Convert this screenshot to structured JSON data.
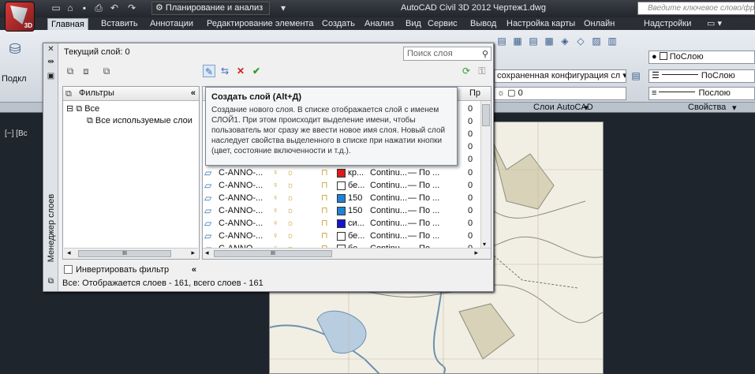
{
  "titlebar": {
    "workspace": "Планирование и анализ",
    "app_title": "AutoCAD Civil 3D 2012",
    "doc_title": "Чертеж1.dwg",
    "help_placeholder": "Введите ключевое слово/фразу",
    "app_tag": "3D"
  },
  "tabs": [
    "Главная",
    "Вставить",
    "Аннотации",
    "Редактирование элемента",
    "Создать",
    "Анализ",
    "Вид",
    "Сервис",
    "Вывод",
    "Настройка карты",
    "Онлайн",
    "Надстройки"
  ],
  "ribbon": {
    "left_panel_label": "Подкл",
    "saved_config": "сохраненная конфигурация сл",
    "layer_combo": "0",
    "layers_panel_title": "Слои AutoCAD",
    "props_panel_title": "Свойства",
    "color_value": "ПоСлою",
    "linetype_value": "ПоСлою",
    "lineweight_value": "Послою"
  },
  "drawing": {
    "viewport_label": "[−] [Вс"
  },
  "palette": {
    "strip_title": "Менеджер слоев",
    "current_layer": "Текущий слой: 0",
    "search_placeholder": "Поиск слоя",
    "filters_header": "Фильтры",
    "tree": {
      "all": "Все",
      "all_used": "Все используемые слои"
    },
    "invert_filter": "Инвертировать фильтр",
    "status": "Все: Отображается слоев - 161, всего слоев - 161",
    "col_pr": "Пр",
    "first_pr_values": [
      "0",
      "0",
      "0",
      "0",
      "0"
    ],
    "rows": [
      {
        "name": "C-ANNO-...",
        "color_name": "кр...",
        "color_hex": "#e01818",
        "linetype": "Continu...",
        "lineweight": "— По ...",
        "pr": "0"
      },
      {
        "name": "C-ANNO-...",
        "color_name": "бе...",
        "color_hex": "#ffffff",
        "linetype": "Continu...",
        "lineweight": "— По ...",
        "pr": "0"
      },
      {
        "name": "C-ANNO-...",
        "color_name": "150",
        "color_hex": "#1e82d8",
        "linetype": "Continu...",
        "lineweight": "— По ...",
        "pr": "0"
      },
      {
        "name": "C-ANNO-...",
        "color_name": "150",
        "color_hex": "#1e82d8",
        "linetype": "Continu...",
        "lineweight": "— По ...",
        "pr": "0"
      },
      {
        "name": "C-ANNO-...",
        "color_name": "си...",
        "color_hex": "#1414d0",
        "linetype": "Continu...",
        "lineweight": "— По ...",
        "pr": "0"
      },
      {
        "name": "C-ANNO-...",
        "color_name": "бе...",
        "color_hex": "#ffffff",
        "linetype": "Continu...",
        "lineweight": "— По ...",
        "pr": "0"
      },
      {
        "name": "C-ANNO-",
        "color_name": "бе...",
        "color_hex": "#ffffff",
        "linetype": "Continu...",
        "lineweight": "— По...",
        "pr": "0"
      }
    ]
  },
  "tooltip": {
    "title": "Создать слой (Alt+Д)",
    "body": "Создание нового слоя. В списке отображается слой с именем СЛОЙ1. При этом происходит выделение имени, чтобы пользователь мог сразу же ввести новое имя слоя. Новый слой наследует свойства выделенного в списке при нажатии кнопки (цвет, состояние включенности и т.д.)."
  }
}
